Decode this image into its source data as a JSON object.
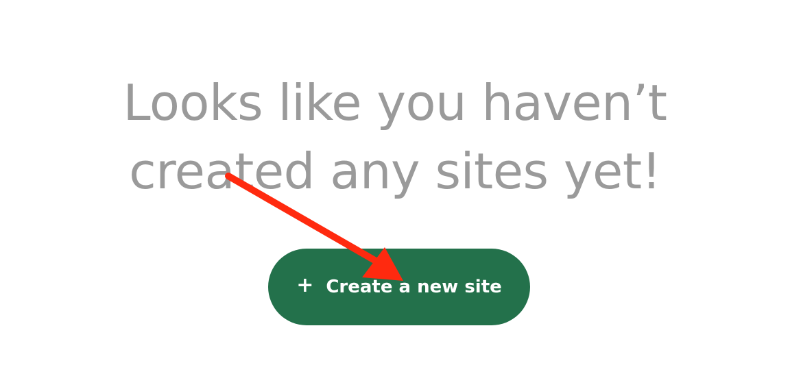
{
  "empty_state": {
    "headline_line1": "Looks like you haven’t",
    "headline_line2": "created any sites yet!"
  },
  "create_button": {
    "icon": "plus-icon",
    "icon_glyph": "+",
    "label": "Create a new site"
  },
  "annotation": {
    "icon": "red-arrow-icon",
    "color": "#ff2a0f"
  },
  "colors": {
    "headline": "#9a9a9a",
    "button_bg": "#23714b",
    "button_text": "#ffffff"
  }
}
